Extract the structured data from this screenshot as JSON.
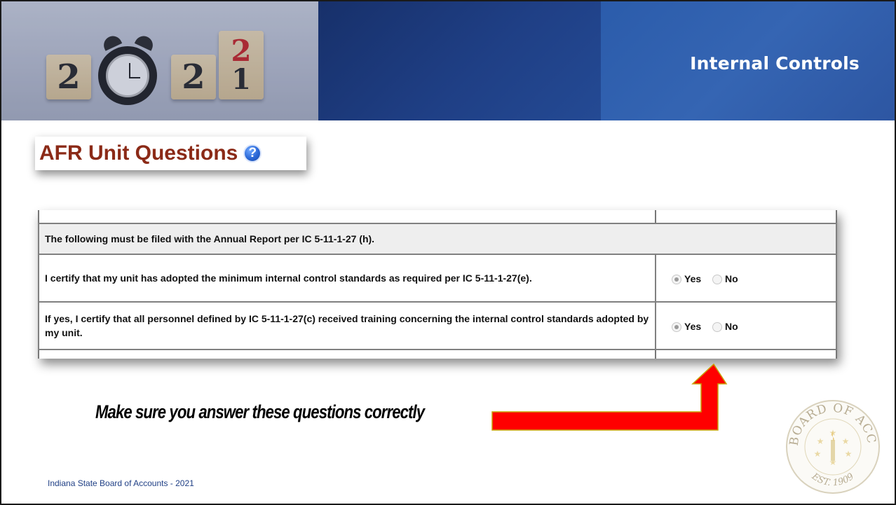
{
  "header": {
    "title": "Internal Controls",
    "image_digits": [
      "2",
      "2",
      "2",
      "1"
    ]
  },
  "screenshot": {
    "title": "AFR Unit Questions",
    "help_icon": "help-question-icon",
    "section_header": "The following must be filed with the Annual Report per IC 5-11-1-27 (h).",
    "questions": [
      {
        "text": "I certify that my unit has adopted the minimum internal control standards as required per IC 5-11-1-27(e).",
        "options": [
          "Yes",
          "No"
        ],
        "selected": "Yes"
      },
      {
        "text": "If yes, I certify that all personnel defined by IC 5-11-1-27(c) received training concerning the internal control standards adopted by my unit.",
        "options": [
          "Yes",
          "No"
        ],
        "selected": "Yes"
      }
    ]
  },
  "annotation": {
    "text": "Make sure you answer these questions correctly",
    "arrow_color": "#ff0000"
  },
  "seal": {
    "top_text": "STATE BOARD OF ACCOUNTS",
    "bottom_text": "EST. 1909"
  },
  "footer": {
    "text": "Indiana State Board of Accounts - 2021"
  },
  "colors": {
    "title_red": "#8b2a17",
    "header_blue": "#1f3f85",
    "header_light_blue": "#3565b3"
  }
}
